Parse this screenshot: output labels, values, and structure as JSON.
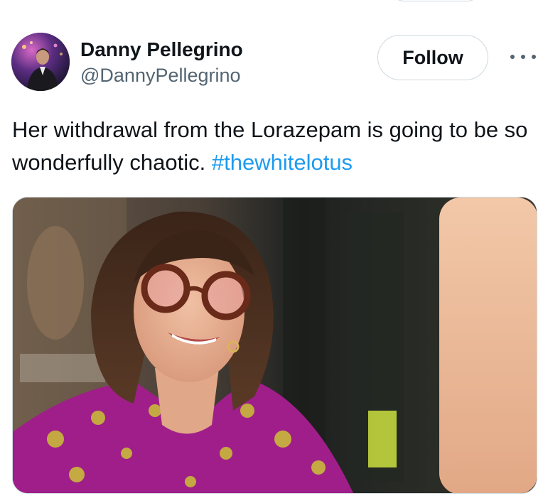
{
  "tweet": {
    "author": {
      "display_name": "Danny Pellegrino",
      "handle": "@DannyPellegrino",
      "avatar_icon": "user-avatar"
    },
    "follow_label": "Follow",
    "more_icon": "more-horizontal-icon",
    "text": "Her withdrawal from the Lorazepam is going to be so wonderfully chaotic. ",
    "hashtag": "#thewhitelotus",
    "media": {
      "type": "photo",
      "icon": "photo-image"
    }
  },
  "colors": {
    "text_primary": "#0f1419",
    "text_secondary": "#536471",
    "link": "#1d9bf0",
    "border": "#cfd9de"
  }
}
